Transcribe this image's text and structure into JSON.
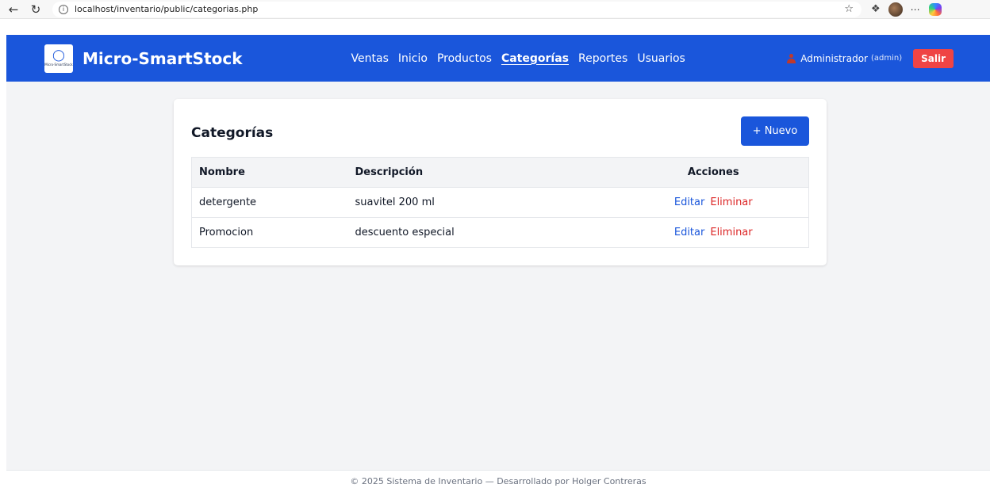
{
  "browser": {
    "url": "localhost/inventario/public/categorias.php"
  },
  "app": {
    "brand": "Micro-SmartStock",
    "logo_text": "Micro-SmartStock",
    "brand_color": "#1a56db",
    "nav": [
      {
        "label": "Ventas",
        "active": false
      },
      {
        "label": "Inicio",
        "active": false
      },
      {
        "label": "Productos",
        "active": false
      },
      {
        "label": "Categorías",
        "active": true
      },
      {
        "label": "Reportes",
        "active": false
      },
      {
        "label": "Usuarios",
        "active": false
      }
    ],
    "user": {
      "name": "Administrador",
      "role": "(admin)"
    },
    "logout_label": "Salir"
  },
  "page": {
    "title": "Categorías",
    "new_button": "+ Nuevo",
    "table": {
      "headers": [
        "Nombre",
        "Descripción",
        "Acciones"
      ],
      "rows": [
        {
          "nombre": "detergente",
          "descripcion": "suavitel 200 ml",
          "edit": "Editar",
          "delete": "Eliminar"
        },
        {
          "nombre": "Promocion",
          "descripcion": "descuento especial",
          "edit": "Editar",
          "delete": "Eliminar"
        }
      ]
    }
  },
  "footer": {
    "text": "© 2025 Sistema de Inventario — Desarrollado por Holger Contreras"
  }
}
